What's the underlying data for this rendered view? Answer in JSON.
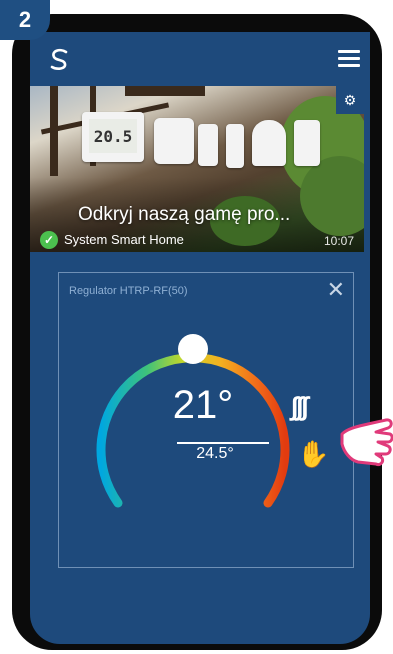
{
  "step": {
    "number": "2"
  },
  "banner": {
    "title": "Odkryj naszą gamę pro...",
    "subtitle": "System Smart Home",
    "time": "10:07",
    "thermostat_display": "20.5"
  },
  "thermostat": {
    "title": "Regulator HTRP-RF(50)",
    "setpoint": "21°",
    "current": "24.5°",
    "setpoint_level_fraction": 0.5
  },
  "colors": {
    "app_bg": "#1e4a7c",
    "card_border": "#6f90b6",
    "check_green": "#4cc04f",
    "badge": "#1f4f82"
  },
  "icons": {
    "logo": "salus-s-logo-icon",
    "menu": "hamburger-menu-icon",
    "settings": "gear-icon",
    "close": "close-icon",
    "heating": "heating-icon",
    "manual": "hand-icon"
  }
}
